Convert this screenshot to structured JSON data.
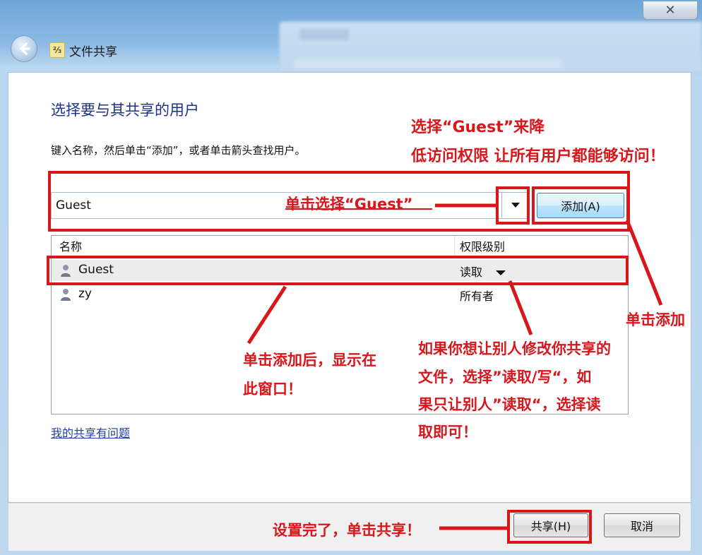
{
  "window": {
    "title": "文件共享",
    "close_glyph": "✕"
  },
  "content": {
    "heading": "选择要与其共享的用户",
    "instruction": "键入名称，然后单击“添加”，或者单击箭头查找用户。",
    "input_value": "Guest",
    "add_button": "添加(A)"
  },
  "table": {
    "columns": [
      "名称",
      "权限级别"
    ],
    "rows": [
      {
        "name": "Guest",
        "permission": "读取",
        "has_dropdown": true
      },
      {
        "name": "zy",
        "permission": "所有者",
        "has_dropdown": false
      }
    ]
  },
  "help_link": "我的共享有问题",
  "footer": {
    "share_button": "共享(H)",
    "cancel_button": "取消"
  },
  "annotations": {
    "choose_guest_line1": "选择“Guest”来降",
    "choose_guest_line2": "低访问权限 让所有用户都能够访问！",
    "click_select_guest": "单击选择“Guest”",
    "click_add": "单击添加",
    "after_add_line1": "单击添加后，显示在",
    "after_add_line2": "此窗口！",
    "permission_line1": "如果你想让别人修改你共享的",
    "permission_line2": "文件，选择”读取/写“，如",
    "permission_line3": "果只让别人”读取“，选择读",
    "permission_line4": "取即可！",
    "finish": "设置完了，单击共享！"
  },
  "colors": {
    "annotation_red": "#d8161b",
    "heading_blue": "#1e3287",
    "link_blue": "#1f3fa6"
  },
  "icons": {
    "back": "back-arrow-icon",
    "wizard": "file-sharing-icon",
    "dropdown": "chevron-down-icon",
    "user": "user-icon"
  }
}
